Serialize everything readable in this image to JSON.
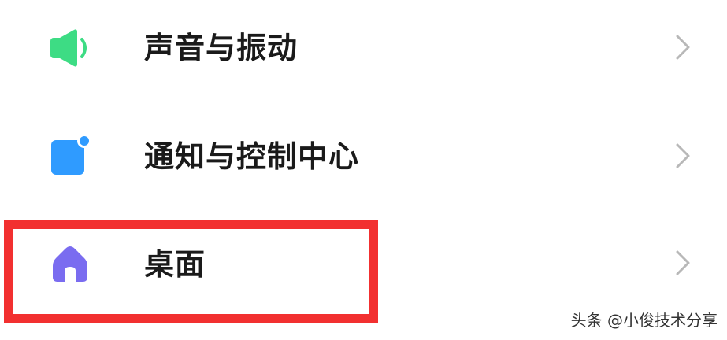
{
  "settings": {
    "items": [
      {
        "label": "声音与振动",
        "icon": "speaker-icon",
        "icon_color": "#3ddc84"
      },
      {
        "label": "通知与控制中心",
        "icon": "notification-icon",
        "icon_color": "#2f9bff"
      },
      {
        "label": "桌面",
        "icon": "home-icon",
        "icon_color": "#7a6cf0"
      }
    ]
  },
  "highlight": {
    "color": "#f23030"
  },
  "watermark": {
    "text": "头条 @小俊技术分享"
  }
}
